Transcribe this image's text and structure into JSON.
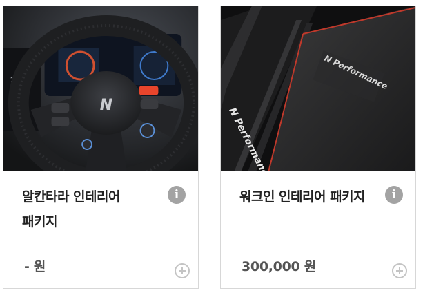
{
  "products": [
    {
      "title": "알칸타라 인테리어 패키지",
      "price": "- 원",
      "image_subject": "steering-wheel-interior",
      "badge_text": "N",
      "info_glyph": "i"
    },
    {
      "title": "워크인 인테리어 패키지",
      "price": "300,000 원",
      "image_subject": "floor-mat",
      "badge_text": "N Performance",
      "info_glyph": "i"
    }
  ],
  "colors": {
    "card_border": "#d7d7d7",
    "title_text": "#222222",
    "price_text": "#555555",
    "info_icon_bg": "#a3a3a3",
    "add_icon": "#c4c4c4",
    "accent_red": "#e8452c"
  }
}
